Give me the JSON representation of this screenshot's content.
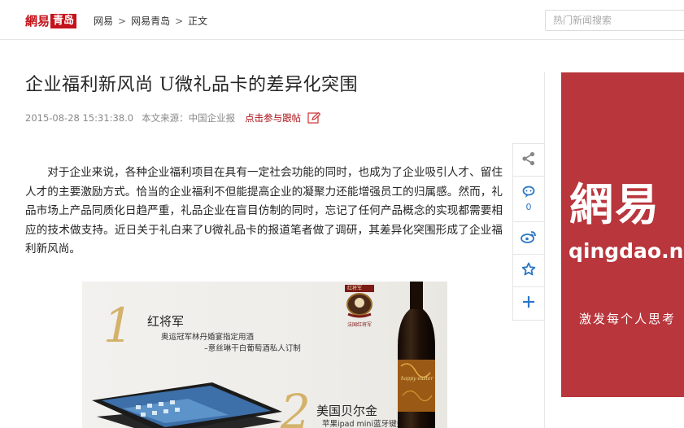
{
  "header": {
    "logo_brand": "網易",
    "logo_channel": "青岛",
    "breadcrumb": [
      "网易",
      "网易青岛",
      "正文"
    ],
    "search_placeholder": "热门新闻搜索"
  },
  "article": {
    "title": "企业福利新风尚 U微礼品卡的差异化突围",
    "datetime": "2015-08-28 15:31:38.0",
    "source": "本文来源：中国企业报",
    "comment_link": "点击参与跟帖",
    "paragraph": "对于企业来说，各种企业福利项目在具有一定社会功能的同时，也成为了企业吸引人才、留住人才的主要激励方式。恰当的企业福利不但能提高企业的凝聚力还能增强员工的归属感。然而，礼品市场上产品同质化日趋严重，礼品企业在盲目仿制的同时，忘记了任何产品概念的实现都需要相应的技术做支持。近日关于礼白来了U微礼品卡的报道笔者做了调研，其差异化突围形成了企业福利新风尚。"
  },
  "share_rail": {
    "icons": [
      "share-icon",
      "comment-icon",
      "weibo-icon",
      "favorite-icon",
      "plus-icon"
    ],
    "comment_count": "0"
  },
  "figure": {
    "item1_number": "1",
    "item1_title": "红将军",
    "item1_desc_line1": "奥运冠军林丹婚宴指定用酒",
    "item1_desc_line2": "–意丝琳干白葡萄酒私人订制",
    "item2_number": "2",
    "item2_title": "美国贝尔金",
    "item2_desc": "苹果ipad mini蓝牙键盘",
    "badge_text": "红将军",
    "badge_caption": "法国红将军",
    "bottle_label": "happy easter"
  },
  "ad": {
    "brand": "網易",
    "domain": "qingdao.net",
    "slogan": "激发每个人思考"
  },
  "colors": {
    "brand_red": "#c4131c",
    "link_red": "#ad0f15",
    "ad_bg": "#b8363c",
    "share_blue": "#2b77c5"
  }
}
